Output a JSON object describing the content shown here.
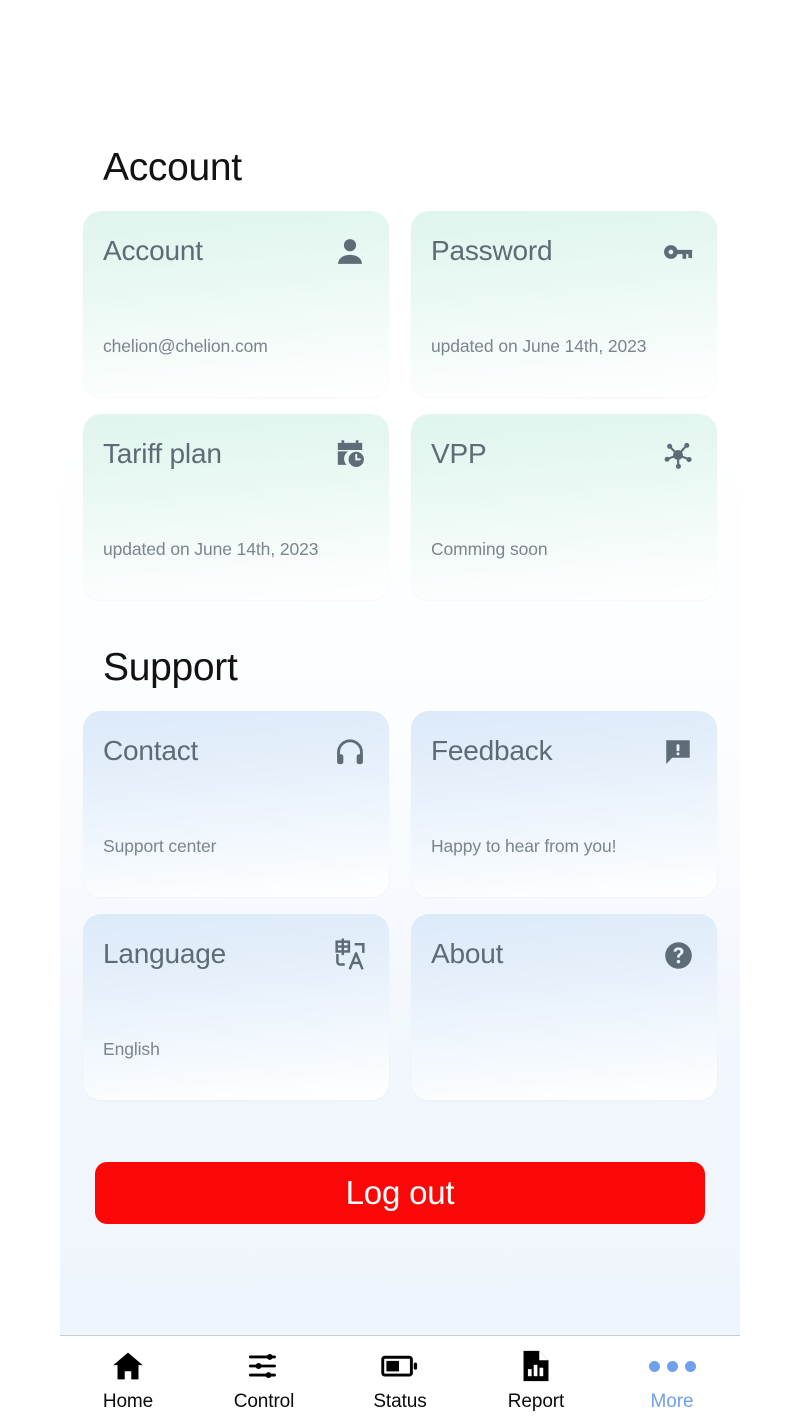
{
  "sections": [
    {
      "id": "account",
      "title": "Account",
      "theme": "mint",
      "cards": [
        {
          "title": "Account",
          "subtitle": "chelion@chelion.com",
          "icon": "person-icon"
        },
        {
          "title": "Password",
          "subtitle": "updated on June 14th, 2023",
          "icon": "key-icon"
        },
        {
          "title": "Tariff plan",
          "subtitle": "updated on June 14th, 2023",
          "icon": "calendar-clock-icon"
        },
        {
          "title": "VPP",
          "subtitle": "Comming soon",
          "icon": "network-hub-icon"
        }
      ]
    },
    {
      "id": "support",
      "title": "Support",
      "theme": "blue",
      "cards": [
        {
          "title": "Contact",
          "subtitle": "Support center",
          "icon": "headphones-icon"
        },
        {
          "title": "Feedback",
          "subtitle": "Happy to hear from you!",
          "icon": "feedback-bubble-icon"
        },
        {
          "title": "Language",
          "subtitle": "English",
          "icon": "translate-icon"
        },
        {
          "title": "About",
          "subtitle": "",
          "icon": "help-circle-icon"
        }
      ]
    }
  ],
  "logout": {
    "label": "Log out"
  },
  "bottom_nav": {
    "items": [
      {
        "label": "Home",
        "icon": "home-icon",
        "active": false
      },
      {
        "label": "Control",
        "icon": "sliders-icon",
        "active": false
      },
      {
        "label": "Status",
        "icon": "battery-icon",
        "active": false
      },
      {
        "label": "Report",
        "icon": "report-icon",
        "active": false
      },
      {
        "label": "More",
        "icon": "more-dots-icon",
        "active": true
      }
    ]
  },
  "colors": {
    "logout_red": "#fc0707",
    "active_blue": "#6fa0ec",
    "card_title": "#5d6b74",
    "card_sub": "#7a858d",
    "icon_gray": "#5e6c78",
    "page_bg": "#ffffff",
    "panel_bottom_bg": "#eef4fb"
  }
}
